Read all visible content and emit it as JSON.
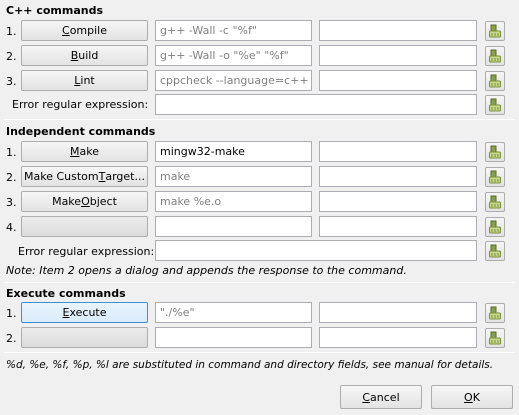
{
  "cpp": {
    "title": "C++ commands",
    "rows": [
      {
        "num": "1.",
        "pre": "",
        "ul": "C",
        "post": "ompile",
        "command": "g++ -Wall -c \"%f\"",
        "workdir": ""
      },
      {
        "num": "2.",
        "pre": "",
        "ul": "B",
        "post": "uild",
        "command": "g++ -Wall -o \"%e\" \"%f\"",
        "workdir": ""
      },
      {
        "num": "3.",
        "pre": "",
        "ul": "L",
        "post": "int",
        "command": "cppcheck --language=c++ -",
        "workdir": ""
      }
    ],
    "error_label": "Error regular expression:",
    "error_value": ""
  },
  "independent": {
    "title": "Independent commands",
    "rows": [
      {
        "num": "1.",
        "pre": "",
        "ul": "M",
        "post": "ake",
        "command": "mingw32-make",
        "command_placeholder": false,
        "workdir": ""
      },
      {
        "num": "2.",
        "pre": "Make Custom ",
        "ul": "T",
        "post": "arget...",
        "command": "make",
        "command_placeholder": true,
        "workdir": ""
      },
      {
        "num": "3.",
        "pre": "Make ",
        "ul": "O",
        "post": "bject",
        "command": "make %e.o",
        "command_placeholder": true,
        "workdir": ""
      },
      {
        "num": "4.",
        "pre": "",
        "ul": "",
        "post": "",
        "command": "",
        "command_placeholder": false,
        "workdir": ""
      }
    ],
    "error_label": "Error regular expression:",
    "error_value": "",
    "note": "Note: Item 2 opens a dialog and appends the response to the command."
  },
  "execute": {
    "title": "Execute commands",
    "rows": [
      {
        "num": "1.",
        "pre": "",
        "ul": "E",
        "post": "xecute",
        "command": "\"./%e\"",
        "workdir": ""
      },
      {
        "num": "2.",
        "pre": "",
        "ul": "",
        "post": "",
        "command": "",
        "workdir": ""
      }
    ]
  },
  "footer_note": "%d, %e, %f, %p, %l are substituted in command and directory fields, see manual for details.",
  "dialog": {
    "cancel_ul": "C",
    "cancel_post": "ancel",
    "ok_ul": "O",
    "ok_post": "K"
  },
  "icons": {
    "reset": "broom-clear-icon"
  },
  "colors": {
    "focus_border": "#3c8fd6",
    "placeholder_text": "#808080"
  }
}
